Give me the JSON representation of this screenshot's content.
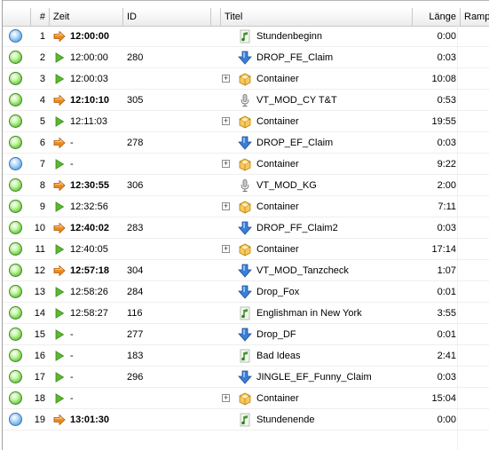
{
  "header": {
    "num": "#",
    "zeit": "Zeit",
    "id": "ID",
    "titel": "Titel",
    "laenge": "Länge",
    "ramp": "Ramp"
  },
  "colors": {
    "orange_arrow": "#f08a1c",
    "green_arrow": "#5cb82e",
    "status_blue": "#4e9ee6",
    "status_green": "#56bb2c"
  },
  "rows": [
    {
      "num": "1",
      "state": "blue",
      "arrow": "orange",
      "time": "12:00:00",
      "bold": true,
      "id": "",
      "expander": false,
      "icon": "music-note-icon",
      "title": "Stundenbeginn",
      "len": "0:00"
    },
    {
      "num": "2",
      "state": "green",
      "arrow": "green",
      "time": "12:00:00",
      "bold": false,
      "id": "280",
      "expander": false,
      "icon": "drop-arrow-icon",
      "title": "DROP_FE_Claim",
      "len": "0:03"
    },
    {
      "num": "3",
      "state": "green",
      "arrow": "green",
      "time": "12:00:03",
      "bold": false,
      "id": "",
      "expander": true,
      "icon": "container-icon",
      "title": "Container",
      "len": "10:08"
    },
    {
      "num": "4",
      "state": "green",
      "arrow": "orange",
      "time": "12:10:10",
      "bold": true,
      "id": "305",
      "expander": false,
      "icon": "microphone-icon",
      "title": "VT_MOD_CY T&T",
      "len": "0:53"
    },
    {
      "num": "5",
      "state": "green",
      "arrow": "green",
      "time": "12:11:03",
      "bold": false,
      "id": "",
      "expander": true,
      "icon": "container-icon",
      "title": "Container",
      "len": "19:55"
    },
    {
      "num": "6",
      "state": "green",
      "arrow": "orange",
      "time": "-",
      "bold": false,
      "id": "278",
      "expander": false,
      "icon": "drop-arrow-icon",
      "title": "DROP_EF_Claim",
      "len": "0:03"
    },
    {
      "num": "7",
      "state": "blue",
      "arrow": "green",
      "time": "-",
      "bold": false,
      "id": "",
      "expander": true,
      "icon": "container-icon",
      "title": "Container",
      "len": "9:22"
    },
    {
      "num": "8",
      "state": "green",
      "arrow": "orange",
      "time": "12:30:55",
      "bold": true,
      "id": "306",
      "expander": false,
      "icon": "microphone-icon",
      "title": "VT_MOD_KG",
      "len": "2:00"
    },
    {
      "num": "9",
      "state": "green",
      "arrow": "green",
      "time": "12:32:56",
      "bold": false,
      "id": "",
      "expander": true,
      "icon": "container-icon",
      "title": "Container",
      "len": "7:11"
    },
    {
      "num": "10",
      "state": "green",
      "arrow": "orange",
      "time": "12:40:02",
      "bold": true,
      "id": "283",
      "expander": false,
      "icon": "drop-arrow-icon",
      "title": "DROP_FF_Claim2",
      "len": "0:03"
    },
    {
      "num": "11",
      "state": "green",
      "arrow": "green",
      "time": "12:40:05",
      "bold": false,
      "id": "",
      "expander": true,
      "icon": "container-icon",
      "title": "Container",
      "len": "17:14"
    },
    {
      "num": "12",
      "state": "green",
      "arrow": "orange",
      "time": "12:57:18",
      "bold": true,
      "id": "304",
      "expander": false,
      "icon": "drop-arrow-icon",
      "title": "VT_MOD_Tanzcheck",
      "len": "1:07"
    },
    {
      "num": "13",
      "state": "green",
      "arrow": "green",
      "time": "12:58:26",
      "bold": false,
      "id": "284",
      "expander": false,
      "icon": "drop-arrow-icon",
      "title": "Drop_Fox",
      "len": "0:01"
    },
    {
      "num": "14",
      "state": "green",
      "arrow": "green",
      "time": "12:58:27",
      "bold": false,
      "id": "116",
      "expander": false,
      "icon": "music-note-icon",
      "title": "Englishman in New York",
      "len": "3:55"
    },
    {
      "num": "15",
      "state": "green",
      "arrow": "green",
      "time": "-",
      "bold": false,
      "id": "277",
      "expander": false,
      "icon": "drop-arrow-icon",
      "title": "Drop_DF",
      "len": "0:01"
    },
    {
      "num": "16",
      "state": "green",
      "arrow": "green",
      "time": "-",
      "bold": false,
      "id": "183",
      "expander": false,
      "icon": "music-note-icon",
      "title": "Bad Ideas",
      "len": "2:41"
    },
    {
      "num": "17",
      "state": "green",
      "arrow": "green",
      "time": "-",
      "bold": false,
      "id": "296",
      "expander": false,
      "icon": "drop-arrow-icon",
      "title": "JINGLE_EF_Funny_Claim",
      "len": "0:03"
    },
    {
      "num": "18",
      "state": "green",
      "arrow": "green",
      "time": "-",
      "bold": false,
      "id": "",
      "expander": true,
      "icon": "container-icon",
      "title": "Container",
      "len": "15:04"
    },
    {
      "num": "19",
      "state": "blue",
      "arrow": "orange",
      "time": "13:01:30",
      "bold": true,
      "id": "",
      "expander": false,
      "icon": "music-note-icon",
      "title": "Stundenende",
      "len": "0:00"
    }
  ]
}
